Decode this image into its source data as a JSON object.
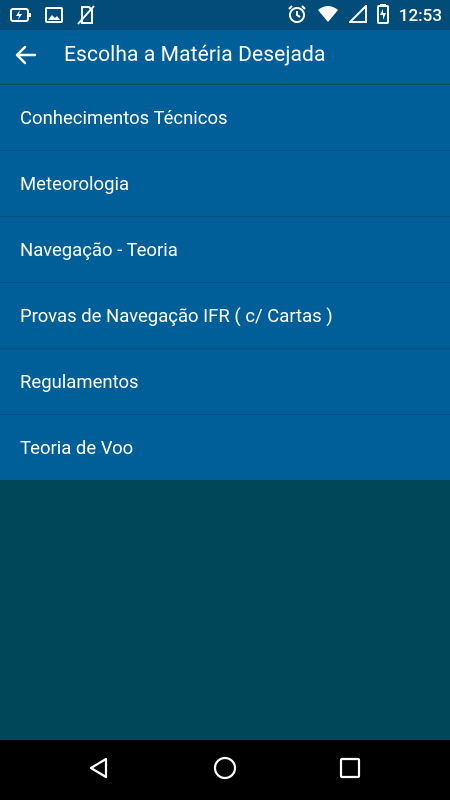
{
  "status_bar": {
    "time": "12:53",
    "left_icons": [
      "battery-charging-icon",
      "image-icon",
      "no-sim-icon"
    ],
    "right_icons": [
      "alarm-icon",
      "wifi-icon",
      "cell-signal-icon",
      "battery-icon"
    ]
  },
  "app_bar": {
    "title": "Escolha a Matéria Desejada",
    "back_icon": "arrow-left-icon",
    "color": "#005e99"
  },
  "subjects": [
    {
      "label": "Conhecimentos Técnicos"
    },
    {
      "label": "Meteorologia"
    },
    {
      "label": "Navegação - Teoria"
    },
    {
      "label": "Provas de Navegação IFR ( c/ Cartas )"
    },
    {
      "label": "Regulamentos"
    },
    {
      "label": "Teoria de Voo"
    }
  ],
  "nav_bar": {
    "icons": [
      "back-triangle-icon",
      "home-circle-icon",
      "recents-square-icon"
    ]
  },
  "colors": {
    "list_bg": "#005e99",
    "divider": "#0a4f7d",
    "empty_bg": "#01475a",
    "status_bg": "#014c78"
  }
}
